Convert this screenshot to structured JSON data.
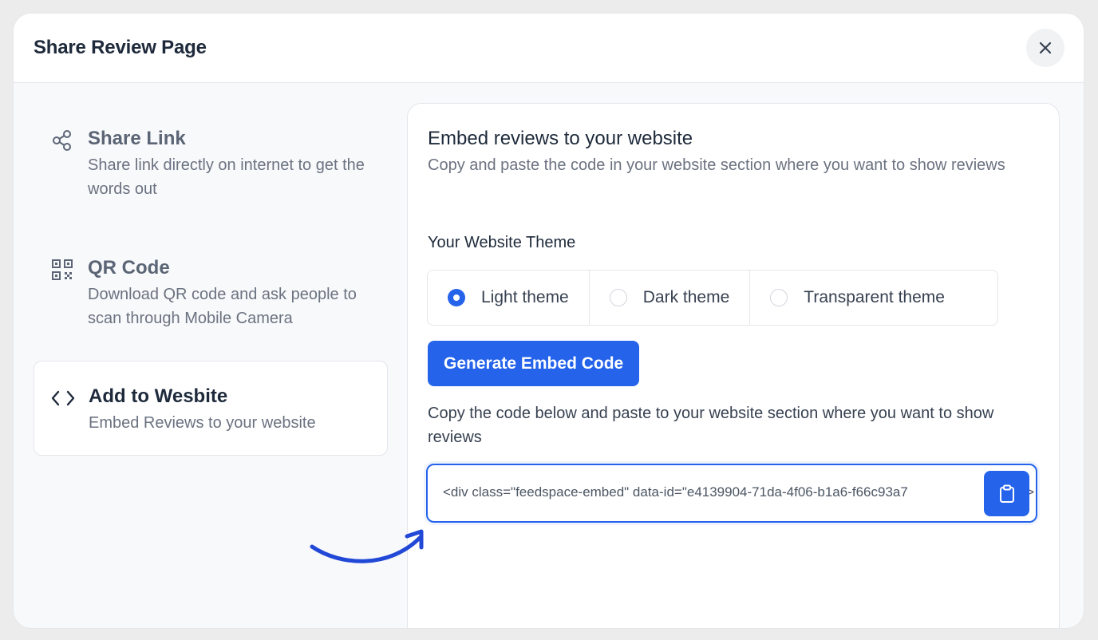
{
  "header": {
    "title": "Share Review Page",
    "close_icon": "close-icon"
  },
  "sidebar": {
    "items": [
      {
        "icon": "share-icon",
        "title": "Share Link",
        "description": "Share link directly on internet to get the words out",
        "active": false
      },
      {
        "icon": "qr-code-icon",
        "title": "QR Code",
        "description": "Download QR code and ask people to scan through Mobile Camera",
        "active": false
      },
      {
        "icon": "code-icon",
        "title": "Add to Wesbite",
        "description": "Embed Reviews to your website",
        "active": true
      }
    ]
  },
  "panel": {
    "title": "Embed reviews to your website",
    "subtitle": "Copy and paste the code in your website section where you want to show reviews",
    "theme_label": "Your Website Theme",
    "themes": [
      {
        "label": "Light theme",
        "selected": true
      },
      {
        "label": "Dark theme",
        "selected": false
      },
      {
        "label": "Transparent theme",
        "selected": false
      }
    ],
    "generate_label": "Generate Embed Code",
    "copy_description": "Copy the code below and paste to your website section where you want to show reviews",
    "code_value": "<div class=\"feedspace-embed\" data-id=\"e4139904-71da-4f06-b1a6-f66c93a7",
    "code_tail": ">",
    "copy_icon": "clipboard-icon"
  },
  "colors": {
    "accent": "#2563eb",
    "annotation_arrow": "#2148d6"
  }
}
